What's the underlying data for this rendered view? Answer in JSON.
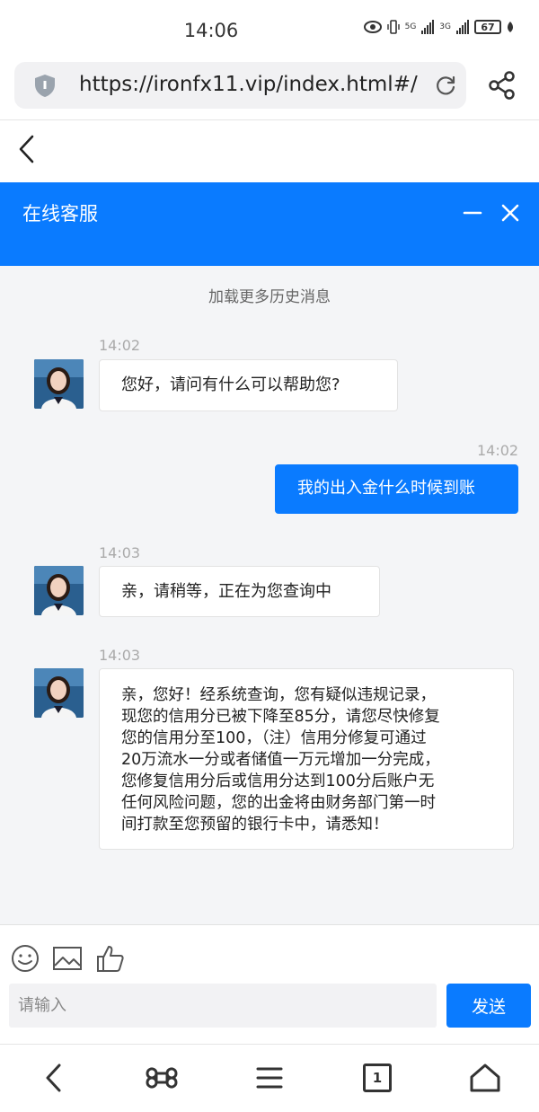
{
  "status_bar": {
    "time": "14:06",
    "network_1": "5G",
    "network_2": "3G",
    "battery": "67"
  },
  "browser": {
    "url": "https://ironfx11.vip/index.html#/"
  },
  "chat": {
    "title": "在线客服",
    "load_more": "加载更多历史消息",
    "messages": [
      {
        "sender": "agent",
        "time": "14:02",
        "text": "您好，请问有什么可以帮助您?"
      },
      {
        "sender": "user",
        "time": "14:02",
        "text": "我的出入金什么时候到账"
      },
      {
        "sender": "agent",
        "time": "14:03",
        "text": "亲，请稍等，正在为您查询中"
      },
      {
        "sender": "agent",
        "time": "14:03",
        "text": "亲，您好！经系统查询，您有疑似违规记录，\n现您的信用分已被下降至85分，请您尽快修复\n您的信用分至100，（注）信用分修复可通过\n20万流水一分或者储值一万元增加一分完成，\n您修复信用分后或信用分达到100分后账户无\n任何风险问题，您的出金将由财务部门第一时\n间打款至您预留的银行卡中，请悉知！"
      }
    ]
  },
  "composer": {
    "placeholder": "请输入",
    "send_label": "发送"
  },
  "bottom_nav": {
    "tab_count": "1"
  },
  "colors": {
    "accent": "#0a7bff",
    "chat_bg": "#f4f5f7"
  },
  "icons": [
    "shield-icon",
    "reload-icon",
    "share-icon",
    "back-icon",
    "minimize-icon",
    "close-icon",
    "emoji-icon",
    "image-icon",
    "thumbs-up-icon",
    "nav-back-icon",
    "command-icon",
    "menu-icon",
    "tabs-icon",
    "home-icon"
  ]
}
